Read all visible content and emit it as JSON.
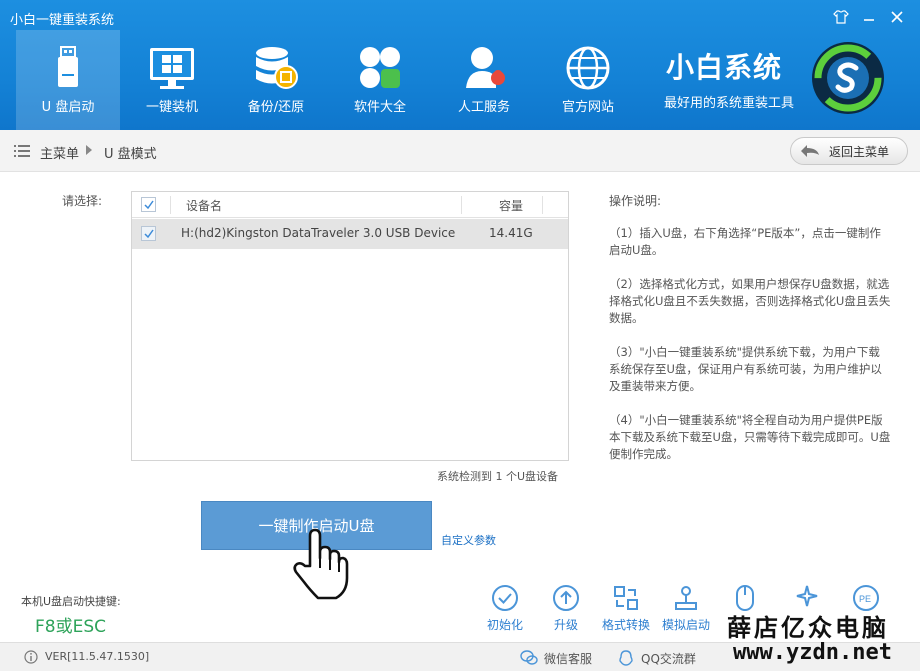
{
  "window": {
    "title": "小白一键重装系统"
  },
  "nav": {
    "items": [
      {
        "label": "U 盘启动",
        "icon": "usb-drive-icon",
        "active": true
      },
      {
        "label": "一键装机",
        "icon": "monitor-windows-icon",
        "active": false
      },
      {
        "label": "备份/还原",
        "icon": "database-backup-icon",
        "active": false
      },
      {
        "label": "软件大全",
        "icon": "apps-grid-icon",
        "active": false
      },
      {
        "label": "人工服务",
        "icon": "support-person-icon",
        "active": false
      },
      {
        "label": "官方网站",
        "icon": "globe-icon",
        "active": false
      }
    ]
  },
  "brand": {
    "title": "小白系统",
    "subtitle": "最好用的系统重装工具",
    "logo": "xiaobai-logo"
  },
  "breadcrumb": {
    "home": "主菜单",
    "current": "U 盘模式",
    "back_label": "返回主菜单"
  },
  "main": {
    "select_label": "请选择:",
    "table": {
      "columns": [
        "设备名",
        "容量"
      ],
      "rows": [
        {
          "device": "H:(hd2)Kingston DataTraveler 3.0 USB Device",
          "capacity": "14.41G",
          "checked": true
        }
      ]
    },
    "detect_text": "系统检测到 1 个U盘设备",
    "make_button": "一键制作启动U盘",
    "custom_link": "自定义参数"
  },
  "instructions": {
    "title": "操作说明:",
    "items": [
      "（1）插入U盘，右下角选择“PE版本”，点击一键制作启动U盘。",
      "（2）选择格式化方式，如果用户想保存U盘数据，就选择格式化U盘且不丢失数据，否则选择格式化U盘且丢失数据。",
      "（3）\"小白一键重装系统\"提供系统下载，为用户下载系统保存至U盘，保证用户有系统可装，为用户维护以及重装带来方便。",
      "（4）\"小白一键重装系统\"将全程自动为用户提供PE版本下载及系统下载至U盘，只需等待下载完成即可。U盘便制作完成。"
    ]
  },
  "bottom": {
    "hotkey_label": "本机U盘启动快捷键:",
    "hotkey_value": "F8或ESC",
    "tools": [
      {
        "label": "初始化",
        "icon": "check-circle-icon"
      },
      {
        "label": "升级",
        "icon": "upload-circle-icon"
      },
      {
        "label": "格式转换",
        "icon": "convert-icon"
      },
      {
        "label": "模拟启动",
        "icon": "joystick-icon"
      }
    ]
  },
  "status": {
    "version": "VER[11.5.47.1530]",
    "items": [
      {
        "label": "微信客服",
        "icon": "wechat-icon"
      },
      {
        "label": "QQ交流群",
        "icon": "qq-icon"
      }
    ]
  },
  "watermark": {
    "text": "薛店亿众电脑",
    "url": "www.yzdn.net"
  },
  "colors": {
    "header": "#1482d6",
    "accent": "#5b9bd5",
    "link": "#1a6fc4",
    "hotkey": "#2ea35a"
  }
}
